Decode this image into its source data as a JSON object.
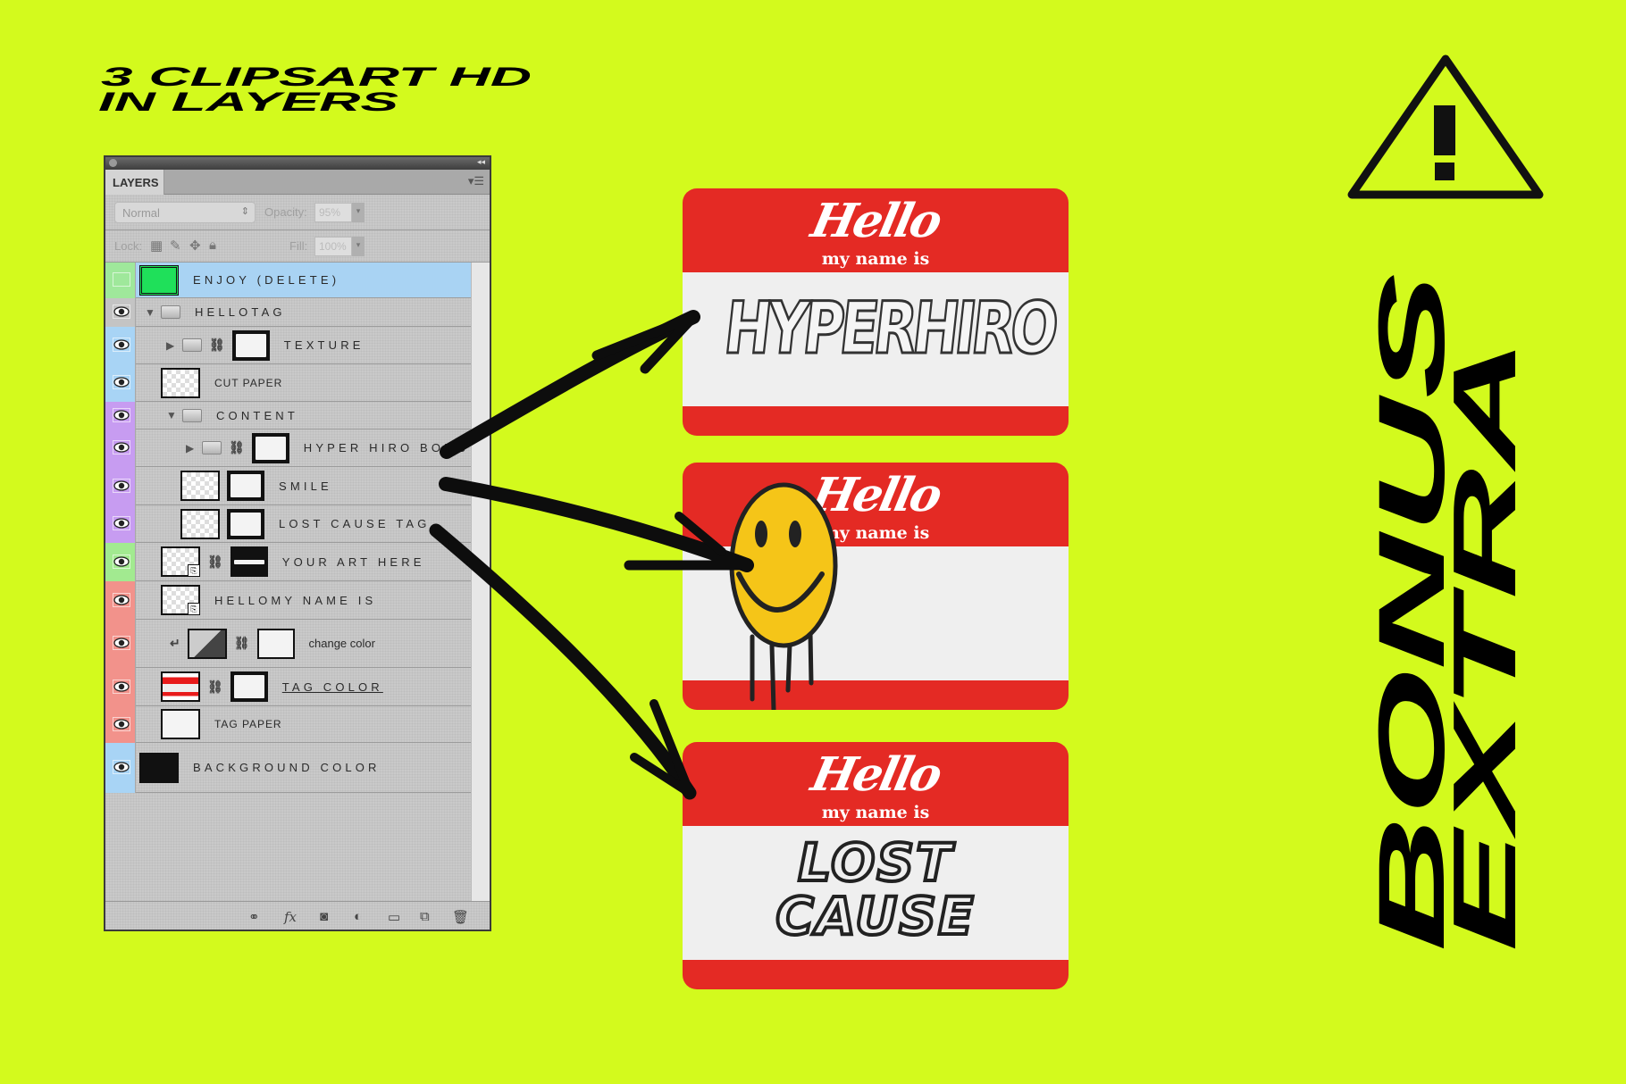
{
  "headline": {
    "line1": "3 CLIPSART HD",
    "line2": "IN LAYERS"
  },
  "side_text": {
    "line1": "BONUS",
    "line2": "EXTRA"
  },
  "colors": {
    "background": "#d3fa1d",
    "tag_red": "#e42a24",
    "ink": "#111111"
  },
  "panel": {
    "tab": "LAYERS",
    "blend_mode": "Normal",
    "opacity_label": "Opacity:",
    "opacity_value": "95%",
    "lock_label": "Lock:",
    "fill_label": "Fill:",
    "fill_value": "100%",
    "layers": [
      {
        "name": "ENJOY (DELETE)",
        "strip": "#9fe89b",
        "visible": false,
        "depth": 0,
        "kind": "layer",
        "thumb": "green",
        "selected": true
      },
      {
        "name": "HELLOTAG",
        "strip": "#c4c4c4",
        "visible": true,
        "depth": 0,
        "kind": "group",
        "expanded": true
      },
      {
        "name": "TEXTURE",
        "strip": "#a8d4f5",
        "visible": true,
        "depth": 1,
        "kind": "group",
        "expanded": false,
        "link": true,
        "mask": "white"
      },
      {
        "name": "CUT PAPER",
        "strip": "#a8d4f5",
        "visible": true,
        "depth": 1,
        "kind": "layer",
        "thumb": "checker",
        "tight": true
      },
      {
        "name": "CONTENT",
        "strip": "#c79cf1",
        "visible": true,
        "depth": 1,
        "kind": "group",
        "expanded": true
      },
      {
        "name": "HYPER HIRO BOMB",
        "strip": "#c79cf1",
        "visible": true,
        "depth": 2,
        "kind": "group",
        "expanded": false,
        "link": true,
        "mask": "white"
      },
      {
        "name": "SMILE",
        "strip": "#c79cf1",
        "visible": true,
        "depth": 2,
        "kind": "layer",
        "thumb": "checker",
        "mask": "white"
      },
      {
        "name": "LOST CAUSE TAG",
        "strip": "#c79cf1",
        "visible": true,
        "depth": 2,
        "kind": "layer",
        "thumb": "checker",
        "mask": "white"
      },
      {
        "name": "YOUR ART HERE",
        "strip": "#a2ea90",
        "visible": true,
        "depth": 1,
        "kind": "smart",
        "thumb": "checker",
        "link": true,
        "mask": "bar"
      },
      {
        "name": "HELLOMY NAME IS",
        "strip": "#f2928b",
        "visible": true,
        "depth": 1,
        "kind": "smart",
        "thumb": "checker"
      },
      {
        "name": "change color",
        "strip": "#f2928b",
        "visible": true,
        "depth": 2,
        "kind": "adjustment",
        "thumb": "adjust",
        "link": true,
        "mask": "plainwhite",
        "clipped": true,
        "lower": true
      },
      {
        "name": "TAG COLOR",
        "strip": "#f2928b",
        "visible": true,
        "depth": 1,
        "kind": "layer",
        "thumb": "tagcolor",
        "link": true,
        "mask": "white",
        "underline": true
      },
      {
        "name": "TAG PAPER",
        "strip": "#f2928b",
        "visible": true,
        "depth": 1,
        "kind": "layer",
        "thumb": "plain",
        "tight": true
      },
      {
        "name": "BACKGROUND COLOR",
        "strip": "#a8d4f5",
        "visible": true,
        "depth": 0,
        "kind": "fill",
        "thumb": "black"
      }
    ],
    "footer_icons": [
      "link-icon",
      "fx-icon",
      "mask-icon",
      "adjustment-icon",
      "folder-icon",
      "new-layer-icon",
      "trash-icon"
    ]
  },
  "tags": [
    {
      "hello": "Hello",
      "my_name_is": "my name is",
      "name": "HYPERHIRO"
    },
    {
      "hello": "Hello",
      "my_name_is": "my name is",
      "name": ""
    },
    {
      "hello": "Hello",
      "my_name_is": "my name is",
      "name": "LOST CAUSE"
    }
  ]
}
